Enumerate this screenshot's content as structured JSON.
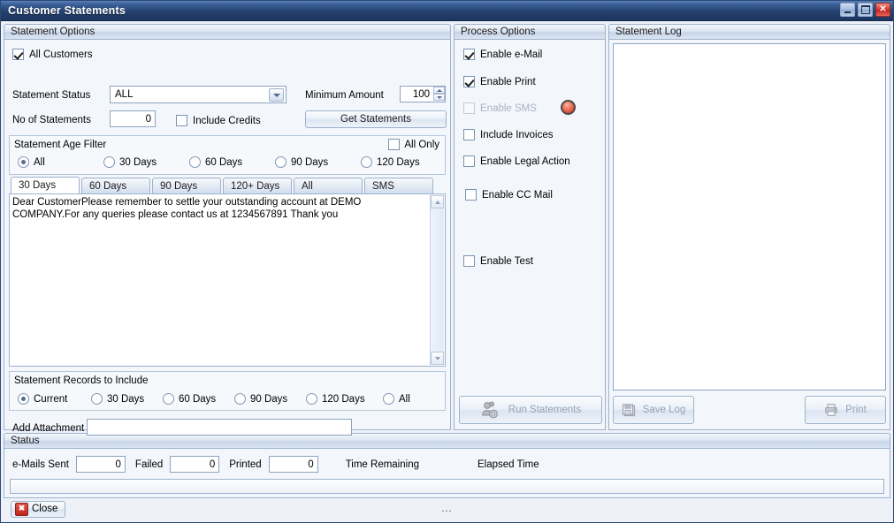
{
  "window": {
    "title": "Customer Statements",
    "controls": {
      "minimize": "_",
      "maximize": "□",
      "close": "✕"
    }
  },
  "statement_options": {
    "header": "Statement Options",
    "all_customers": {
      "label": "All Customers",
      "checked": true
    },
    "statement_status": {
      "label": "Statement Status",
      "value": "ALL"
    },
    "minimum_amount": {
      "label": "Minimum Amount",
      "value": "100"
    },
    "no_of_statements": {
      "label": "No of Statements",
      "value": "0"
    },
    "include_credits": {
      "label": "Include Credits",
      "checked": false
    },
    "get_statements_button": "Get Statements",
    "age_filter": {
      "header": "Statement Age Filter",
      "all_only": {
        "label": "All Only",
        "checked": false
      },
      "options": [
        {
          "label": "All",
          "selected": true
        },
        {
          "label": "30 Days",
          "selected": false
        },
        {
          "label": "60 Days",
          "selected": false
        },
        {
          "label": "90 Days",
          "selected": false
        },
        {
          "label": "120 Days",
          "selected": false
        }
      ]
    },
    "message_tabs": [
      {
        "label": "30 Days",
        "active": true
      },
      {
        "label": "60 Days",
        "active": false
      },
      {
        "label": "90 Days",
        "active": false
      },
      {
        "label": "120+ Days",
        "active": false
      },
      {
        "label": "All",
        "active": false
      },
      {
        "label": "SMS",
        "active": false
      }
    ],
    "message_text": "Dear CustomerPlease remember to settle your outstanding account at DEMO COMPANY.For any queries please contact us at 1234567891 Thank you",
    "records_to_include": {
      "header": "Statement Records to Include",
      "options": [
        {
          "label": "Current",
          "selected": true
        },
        {
          "label": "30 Days",
          "selected": false
        },
        {
          "label": "60 Days",
          "selected": false
        },
        {
          "label": "90 Days",
          "selected": false
        },
        {
          "label": "120 Days",
          "selected": false
        },
        {
          "label": "All",
          "selected": false
        }
      ]
    },
    "add_attachment": {
      "label": "Add Attachment",
      "value": ""
    }
  },
  "process_options": {
    "header": "Process Options",
    "items": [
      {
        "label": "Enable e-Mail",
        "checked": true,
        "disabled": false
      },
      {
        "label": "Enable Print",
        "checked": true,
        "disabled": false
      },
      {
        "label": "Enable SMS",
        "checked": false,
        "disabled": true
      },
      {
        "label": "Include Invoices",
        "checked": false,
        "disabled": false
      },
      {
        "label": "Enable Legal Action",
        "checked": false,
        "disabled": false
      },
      {
        "label": "Enable CC Mail",
        "checked": false,
        "disabled": false
      },
      {
        "label": "Enable Test",
        "checked": false,
        "disabled": false
      }
    ],
    "sms_led_color": "#e0513a",
    "run_button": {
      "label": "Run Statements",
      "disabled": true
    }
  },
  "statement_log": {
    "header": "Statement Log",
    "text": "",
    "save_button": {
      "label": "Save Log",
      "disabled": true
    },
    "print_button": {
      "label": "Print",
      "disabled": true
    }
  },
  "status": {
    "header": "Status",
    "emails_sent": {
      "label": "e-Mails Sent",
      "value": "0"
    },
    "failed": {
      "label": "Failed",
      "value": "0"
    },
    "printed": {
      "label": "Printed",
      "value": "0"
    },
    "time_remaining": {
      "label": "Time Remaining",
      "value": ""
    },
    "elapsed_time": {
      "label": "Elapsed Time",
      "value": ""
    },
    "progress_text": ""
  },
  "footer": {
    "close_button": "Close",
    "dots": "..."
  }
}
